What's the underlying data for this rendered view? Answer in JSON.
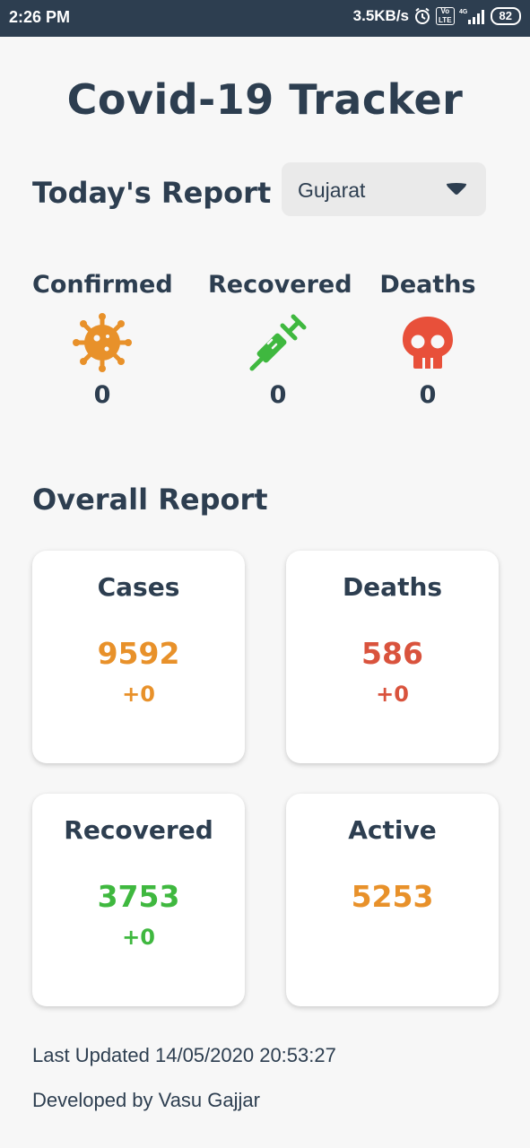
{
  "status_bar": {
    "time": "2:26 PM",
    "speed": "3.5KB/s",
    "network": "4G",
    "battery": "82",
    "icons": [
      "alarm-icon",
      "volte-icon",
      "signal-icon",
      "battery-icon"
    ]
  },
  "app": {
    "title": "Covid-19 Tracker"
  },
  "today": {
    "title": "Today's Report",
    "state_dropdown": {
      "selected": "Gujarat",
      "icon": "caret-down-icon"
    },
    "stats": [
      {
        "label": "Confirmed",
        "value": "0",
        "icon": "virus-icon",
        "color": "#e8912a"
      },
      {
        "label": "Recovered",
        "value": "0",
        "icon": "syringe-icon",
        "color": "#3fb83f"
      },
      {
        "label": "Deaths",
        "value": "0",
        "icon": "skull-icon",
        "color": "#e8503a"
      }
    ]
  },
  "overall": {
    "title": "Overall Report",
    "cards": [
      {
        "title": "Cases",
        "value": "9592",
        "delta": "+0",
        "color": "#e8912a"
      },
      {
        "title": "Deaths",
        "value": "586",
        "delta": "+0",
        "color": "#d9533d"
      },
      {
        "title": "Recovered",
        "value": "3753",
        "delta": "+0",
        "color": "#3fb83f"
      },
      {
        "title": "Active",
        "value": "5253",
        "color": "#e8912a"
      }
    ]
  },
  "footer": {
    "last_updated": "Last Updated 14/05/2020 20:53:27",
    "developer": "Developed by Vasu Gajjar"
  },
  "colors": {
    "primary": "#2d3e50",
    "background": "#f7f7f7"
  }
}
